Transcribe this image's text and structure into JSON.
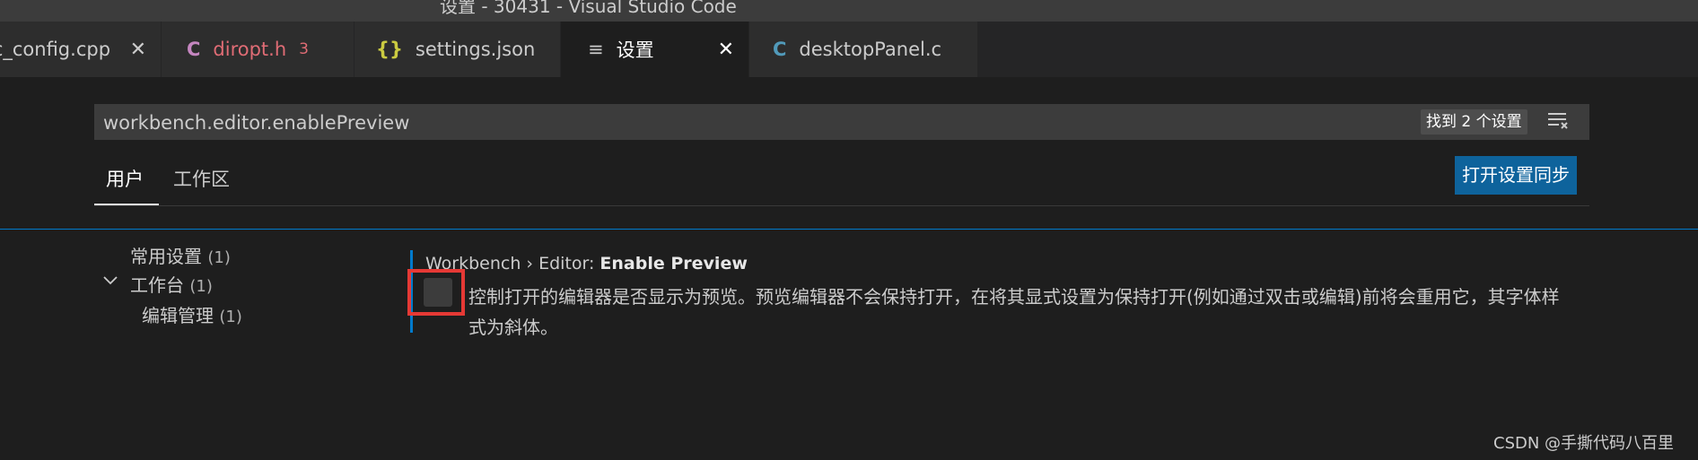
{
  "window": {
    "title": "设置 - 30431 - Visual Studio Code"
  },
  "tabs": [
    {
      "label": "ic_config.cpp",
      "close": "✕"
    },
    {
      "icon": "C",
      "label": "diropt.h",
      "badge": "3",
      "icon_color": "#c586c0",
      "label_color": "#e06c75"
    },
    {
      "icon": "{}",
      "label": "settings.json",
      "icon_color": "#cbcb41"
    },
    {
      "icon": "≡",
      "label": "设置",
      "close": "✕",
      "active": true
    },
    {
      "icon": "C",
      "label": "desktopPanel.c",
      "icon_color": "#519aba"
    }
  ],
  "search": {
    "value": "workbench.editor.enablePreview",
    "result_count": "找到 2 个设置",
    "filter_icon": "clear-filter-icon"
  },
  "scope_tabs": {
    "user": "用户",
    "workspace": "工作区"
  },
  "sync_button": "打开设置同步",
  "toc": {
    "common": {
      "label": "常用设置",
      "count": "(1)"
    },
    "workbench": {
      "label": "工作台",
      "count": "(1)"
    },
    "editor_mgmt": {
      "label": "编辑管理",
      "count": "(1)"
    }
  },
  "setting": {
    "category": "Workbench › Editor: ",
    "name": "Enable Preview",
    "checked": false,
    "description": "控制打开的编辑器是否显示为预览。预览编辑器不会保持打开，在将其显式设置为保持打开(例如通过双击或编辑)前将会重用它，其字体样式为斜体。"
  },
  "watermark": "CSDN @手撕代码八百里",
  "colors": {
    "accent": "#007acc",
    "button": "#0e639c",
    "highlight": "#e53935"
  }
}
